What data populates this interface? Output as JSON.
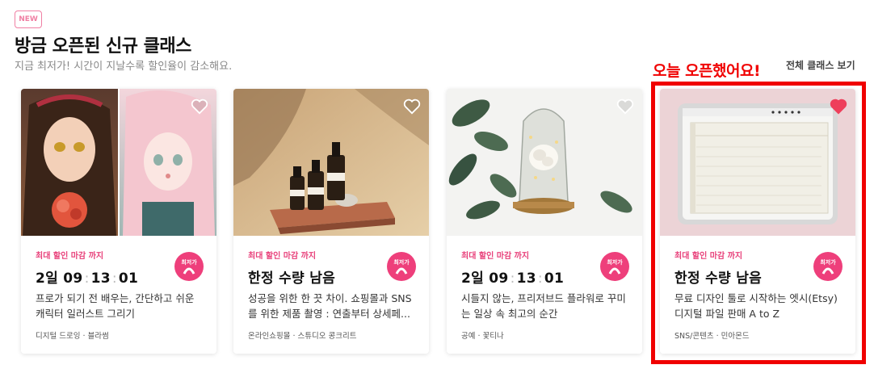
{
  "section": {
    "badge": "NEW",
    "title": "방금 오픈된 신규 클래스",
    "subtitle": "지금 최저가! 시간이 지날수록 할인율이 감소해요.",
    "annotation": "오늘 오픈했어요!",
    "view_all": "전체 클래스 보기"
  },
  "colors": {
    "accent": "#ee3f7b",
    "annotation": "#f00000"
  },
  "cards": [
    {
      "deal_label": "최대 할인 마감 까지",
      "countdown": {
        "days": "2일",
        "h": "09",
        "m": "13",
        "s": "01"
      },
      "description": "프로가 되기 전 배우는, 간단하고 쉬운 캐릭터 일러스트 그리기",
      "meta": "디지털 드로잉 · 블라썸",
      "badge": "최저가",
      "favorited": false
    },
    {
      "deal_label": "최대 할인 마감 까지",
      "status": "한정 수량 남음",
      "description": "성공을 위한 한 끗 차이. 쇼핑몰과 SNS를 위한 제품 촬영 : 연출부터 상세페...",
      "meta": "온라인쇼핑몰 · 스튜디오 콩크리트",
      "badge": "최저가",
      "favorited": false
    },
    {
      "deal_label": "최대 할인 마감 까지",
      "countdown": {
        "days": "2일",
        "h": "09",
        "m": "13",
        "s": "01"
      },
      "description": "시들지 않는, 프리저브드 플라워로 꾸미는 일상 속 최고의 순간",
      "meta": "공예 · 꽃티나",
      "badge": "최저가",
      "favorited": false
    },
    {
      "deal_label": "최대 할인 마감 까지",
      "status": "한정 수량 남음",
      "description": "무료 디자인 툴로 시작하는 엣시(Etsy) 디지털 파일 판매 A to Z",
      "meta": "SNS/콘텐츠 · 민아몬드",
      "badge": "최저가",
      "favorited": true
    }
  ]
}
